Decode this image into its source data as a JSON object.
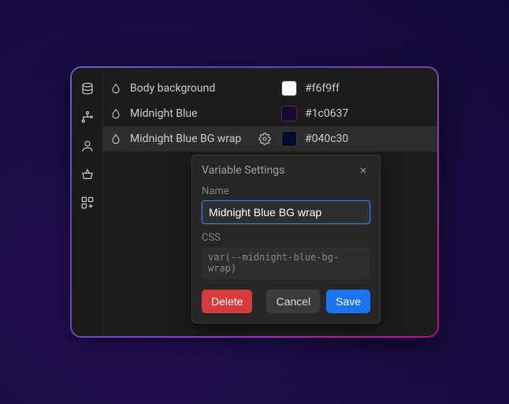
{
  "sidebar": {
    "items": [
      {
        "name": "database"
      },
      {
        "name": "hierarchy"
      },
      {
        "name": "user"
      },
      {
        "name": "basket"
      },
      {
        "name": "apps"
      }
    ]
  },
  "variables": [
    {
      "label": "Body background",
      "hex": "#f6f9ff",
      "swatch": "#f6f9ff",
      "selected": false,
      "gear": false
    },
    {
      "label": "Midnight Blue",
      "hex": "#1c0637",
      "swatch": "#1c0637",
      "selected": false,
      "gear": false
    },
    {
      "label": "Midnight Blue BG wrap",
      "hex": "#040c30",
      "swatch": "#040c30",
      "selected": true,
      "gear": true
    }
  ],
  "popover": {
    "title": "Variable Settings",
    "name_label": "Name",
    "name_value": "Midnight Blue BG wrap",
    "css_label": "CSS",
    "css_value": "var(--midnight-blue-bg-wrap)",
    "delete": "Delete",
    "cancel": "Cancel",
    "save": "Save"
  }
}
